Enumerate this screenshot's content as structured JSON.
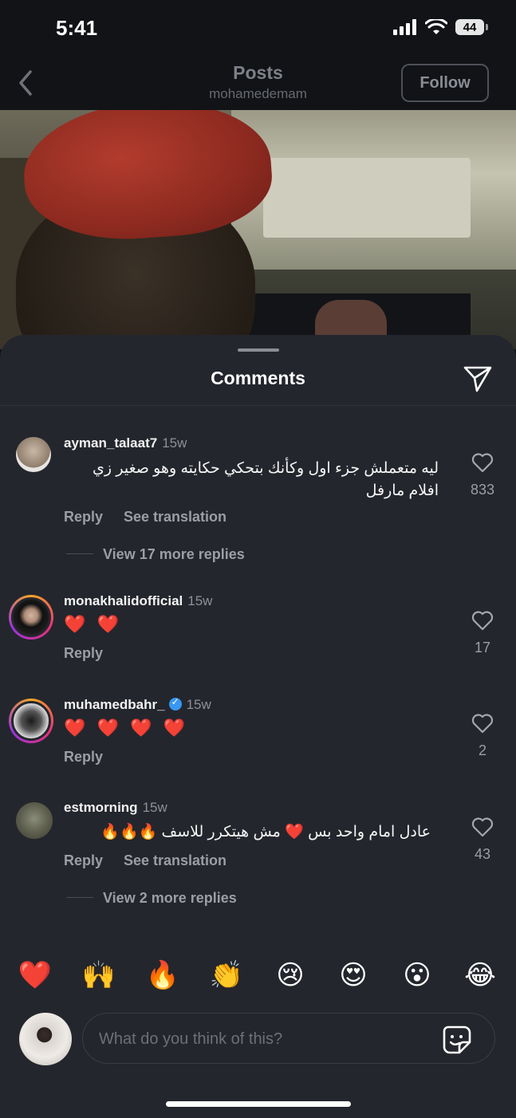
{
  "status_bar": {
    "time": "5:41",
    "battery": "44"
  },
  "header": {
    "title": "Posts",
    "subtitle": "mohamedemam",
    "follow_label": "Follow"
  },
  "sheet": {
    "title": "Comments"
  },
  "comments": [
    {
      "username": "ayman_talaat7",
      "time": "15w",
      "text": "ليه متعملش جزء اول وكأنك بتحكي حكايته وهو صغير زي افلام مارفل",
      "likes": "833",
      "reply": "Reply",
      "translate": "See translation",
      "view_more": "View 17 more replies"
    },
    {
      "username": "monakhalidofficial",
      "time": "15w",
      "text": "❤️ ❤️",
      "likes": "17",
      "reply": "Reply"
    },
    {
      "username": "muhamedbahr_",
      "time": "15w",
      "verified": true,
      "text": "❤️ ❤️ ❤️ ❤️",
      "likes": "2",
      "reply": "Reply"
    },
    {
      "username": "estmorning",
      "time": "15w",
      "text": "عادل امام واحد بس ❤️ مش هيتكرر للاسف 🔥🔥🔥",
      "likes": "43",
      "reply": "Reply",
      "translate": "See translation",
      "view_more": "View 2 more replies"
    }
  ],
  "emoji_bar": [
    "❤️",
    "🙌",
    "🔥",
    "👏",
    "😢",
    "😍",
    "😮",
    "😂"
  ],
  "composer": {
    "placeholder": "What do you think of this?"
  },
  "colors": {
    "background": "#111317",
    "sheet": "#24262d",
    "muted_text": "#9b9ea4",
    "verified": "#3897f0"
  },
  "icons": [
    "back-chevron-icon",
    "send-icon",
    "heart-outline-icon",
    "sticker-icon",
    "verified-badge-icon",
    "signal-icon",
    "wifi-icon",
    "battery-icon"
  ]
}
